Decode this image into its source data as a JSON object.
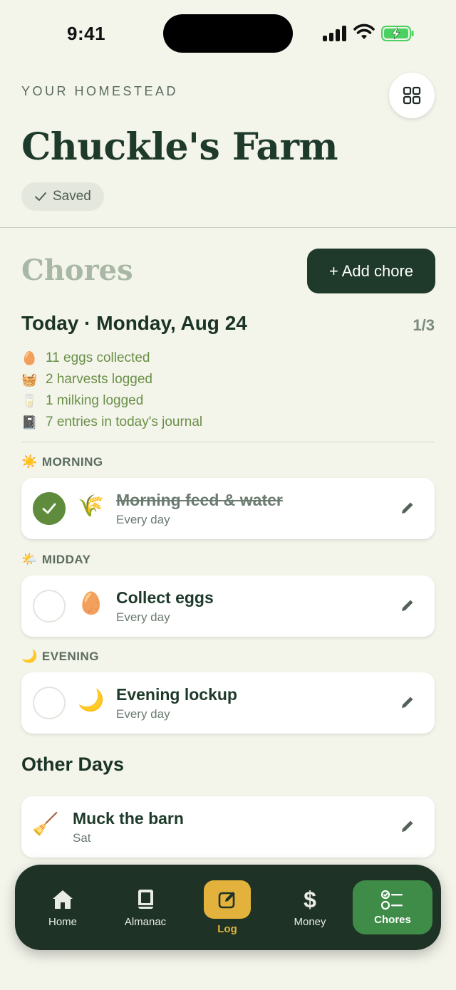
{
  "status": {
    "time": "9:41"
  },
  "header": {
    "eyebrow": "YOUR HOMESTEAD",
    "farm_name": "Chuckle's Farm",
    "saved_label": "Saved",
    "grid_icon": "grid-icon"
  },
  "chores": {
    "title": "Chores",
    "add_label": "+ Add chore",
    "today_heading": "Today · Monday, Aug 24",
    "today_progress": "1/3",
    "summary": [
      {
        "emoji": "🥚",
        "text": "11 eggs collected"
      },
      {
        "emoji": "🧺",
        "text": "2 harvests logged"
      },
      {
        "emoji": "🥛",
        "text": "1 milking logged"
      },
      {
        "emoji": "📓",
        "text": "7 entries in today's journal"
      }
    ],
    "periods": {
      "morning": {
        "emoji": "☀️",
        "label": "MORNING"
      },
      "midday": {
        "emoji": "🌤️",
        "label": "MIDDAY"
      },
      "evening": {
        "emoji": "🌙",
        "label": "EVENING"
      }
    },
    "items": [
      {
        "title": "Morning feed & water",
        "schedule": "Every day",
        "emoji": "🌾",
        "done": true
      },
      {
        "title": "Collect eggs",
        "schedule": "Every day",
        "emoji": "🥚",
        "done": false
      },
      {
        "title": "Evening lockup",
        "schedule": "Every day",
        "emoji": "🌙",
        "done": false
      }
    ],
    "other_heading": "Other Days",
    "other_items": [
      {
        "title": "Muck the barn",
        "schedule": "Sat",
        "emoji": "🧹"
      }
    ]
  },
  "tabbar": {
    "tabs": [
      {
        "label": "Home",
        "icon": "house-icon"
      },
      {
        "label": "Almanac",
        "icon": "book-icon"
      },
      {
        "label": "Log",
        "icon": "edit-icon"
      },
      {
        "label": "Money",
        "icon": "dollar-icon"
      },
      {
        "label": "Chores",
        "icon": "checklist-icon"
      }
    ],
    "active": "Chores"
  },
  "colors": {
    "background": "#f3f4ea",
    "primary_dark": "#1f3a2b",
    "accent_green": "#5e8c3c",
    "active_tab": "#3e8c47",
    "log_accent": "#e3b23c"
  }
}
